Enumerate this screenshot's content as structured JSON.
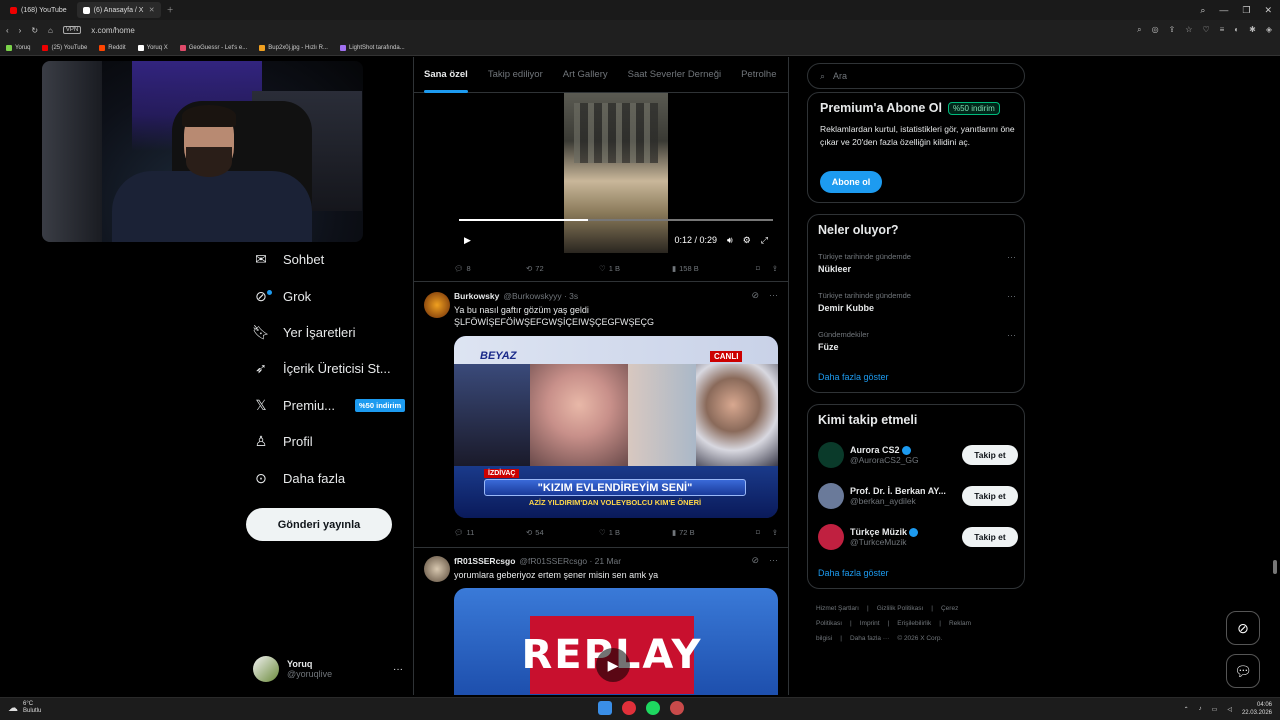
{
  "browser": {
    "tabs": [
      {
        "label": "(168) YouTube"
      },
      {
        "label": "(6) Anasayfa / X"
      }
    ],
    "address": "x.com/home",
    "vpn_label": "VPN",
    "bookmarks": [
      {
        "label": "Yoruq",
        "color": "#7bd34a"
      },
      {
        "label": "(25) YouTube",
        "color": "#e00"
      },
      {
        "label": "Reddit",
        "color": "#ff4500"
      },
      {
        "label": "Yoruq X",
        "color": "#fff"
      },
      {
        "label": "GeoGuessr - Let's e...",
        "color": "#e04a6a"
      },
      {
        "label": "Bup2x0j.jpg - Hızlı R...",
        "color": "#f0a020"
      },
      {
        "label": "LightShot tarafında...",
        "color": "#a070f0"
      }
    ]
  },
  "nav": {
    "chat": "Sohbet",
    "grok": "Grok",
    "bookmarks": "Yer İşaretleri",
    "creator": "İçerik Üreticisi St...",
    "premium": "Premiu...",
    "premium_badge": "%50 indirim",
    "profile": "Profil",
    "more": "Daha fazla",
    "post_button": "Gönderi yayınla"
  },
  "account": {
    "name": "Yoruq",
    "handle": "@yoruqlive",
    "more": "···"
  },
  "timeline": {
    "tabs": [
      "Sana özel",
      "Takip ediliyor",
      "Art Gallery",
      "Saat Severler Derneği",
      "Petrolhe"
    ],
    "video": {
      "time": "0:12 / 0:29",
      "progress": 0.41
    },
    "post0_actions": {
      "replies": "8",
      "reposts": "72",
      "likes": "1 B",
      "views": "158 B"
    },
    "posts": [
      {
        "name": "Burkowsky",
        "handle": "@Burkowskyyy · 3s",
        "text1": "Ya bu nasıl gaftır gözüm yaş geldi",
        "text2": "ŞLFÖWİŞEFÖİWŞEFGWŞİÇEIWŞÇEGFWŞEÇG",
        "tv": {
          "logo": "BEYAZ",
          "live": "CANLI",
          "tag": "İZDİVAÇ",
          "headline": "\"KIZIM EVLENDİREYİM SENİ\"",
          "sub": "AZİZ YILDIRIM'DAN VOLEYBOLCU KIM'E ÖNERİ"
        },
        "actions": {
          "replies": "11",
          "reposts": "54",
          "likes": "1 B",
          "views": "72 B"
        }
      },
      {
        "name": "fR01SSERcsgo",
        "handle": "@fR01SSERcsgo · 21 Mar",
        "text1": "yorumlara geberiyoz ertem şener misin sen amk ya",
        "replay": "REPLAY"
      }
    ]
  },
  "right": {
    "search_placeholder": "Ara",
    "premium": {
      "title": "Premium'a Abone Ol",
      "badge": "%50 indirim",
      "text": "Reklamlardan kurtul, istatistikleri gör, yanıtlarını öne çıkar ve 20'den fazla özelliğin kilidini aç.",
      "button": "Abone ol"
    },
    "trends": {
      "title": "Neler oluyor?",
      "items": [
        {
          "context": "Türkiye tarihinde gündemde",
          "topic": "Nükleer"
        },
        {
          "context": "Türkiye tarihinde gündemde",
          "topic": "Demir Kubbe"
        },
        {
          "context": "Gündemdekiler",
          "topic": "Füze"
        }
      ],
      "show_more": "Daha fazla göster"
    },
    "who_to_follow": {
      "title": "Kimi takip etmeli",
      "items": [
        {
          "name": "Aurora CS2",
          "handle": "@AuroraCS2_GG",
          "verified": true,
          "button": "Takip et",
          "color": "#0a3a2a"
        },
        {
          "name": "Prof. Dr. İ. Berkan AY...",
          "handle": "@berkan_aydilek",
          "verified": false,
          "button": "Takip et",
          "color": "#6a7a9a"
        },
        {
          "name": "Türkçe Müzik",
          "handle": "@TurkceMuzik",
          "verified": true,
          "button": "Takip et",
          "color": "#c02040"
        }
      ],
      "show_more": "Daha fazla göster"
    },
    "footer": [
      "Hizmet Şartları",
      "|",
      "Gizlilik Politikası",
      "|",
      "Çerez Politikası",
      "|",
      "Imprint",
      "|",
      "Erişilebilirlik",
      "|",
      "Reklam bilgisi",
      "|",
      "Daha fazla ···",
      "© 2026 X Corp."
    ]
  },
  "taskbar": {
    "temp": "6°C",
    "weather": "Bulutlu",
    "time": "04:06",
    "date": "22.03.2026"
  }
}
